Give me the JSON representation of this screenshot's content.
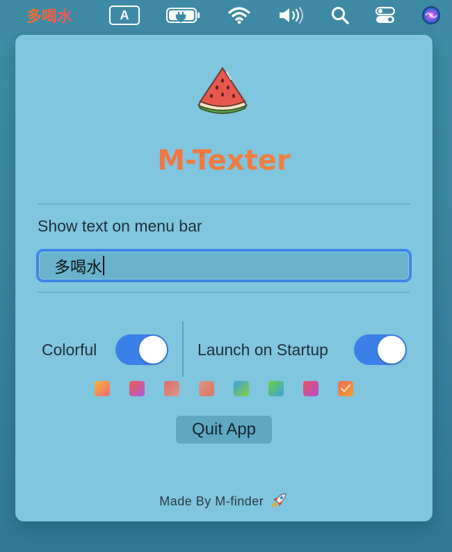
{
  "menubar": {
    "app_text": "多喝水",
    "input_source": "A"
  },
  "panel": {
    "title": "M-Texter",
    "show_text_label": "Show text on menu bar",
    "text_value": "多喝水",
    "colorful_label": "Colorful",
    "colorful_on": true,
    "startup_label": "Launch on Startup",
    "startup_on": true,
    "quit_label": "Quit App",
    "footer": "Made By M-finder"
  },
  "colors": {
    "title_gradient": [
      "#f36a4c",
      "#f08a32"
    ],
    "accent_blue": "#3d7fe8",
    "panel_bg": "#7fc6de"
  },
  "swatches": [
    {
      "from": "#f5b335",
      "to": "#f06a7a",
      "selected": false
    },
    {
      "from": "#f05a4a",
      "to": "#b05ae0",
      "selected": false
    },
    {
      "from": "#e46a6a",
      "to": "#d49a8a",
      "selected": false
    },
    {
      "from": "#d89a8a",
      "to": "#e07060",
      "selected": false
    },
    {
      "from": "#3aa0e0",
      "to": "#8ad040",
      "selected": false
    },
    {
      "from": "#6ad040",
      "to": "#40a0e0",
      "selected": false
    },
    {
      "from": "#f05060",
      "to": "#b050d0",
      "selected": false
    },
    {
      "from": "#f06a5a",
      "to": "#f0a030",
      "selected": true
    }
  ],
  "icons": [
    "battery-charging-icon",
    "wifi-icon",
    "volume-icon",
    "search-icon",
    "control-center-icon",
    "siri-icon",
    "watermelon-icon",
    "rocket-icon"
  ]
}
